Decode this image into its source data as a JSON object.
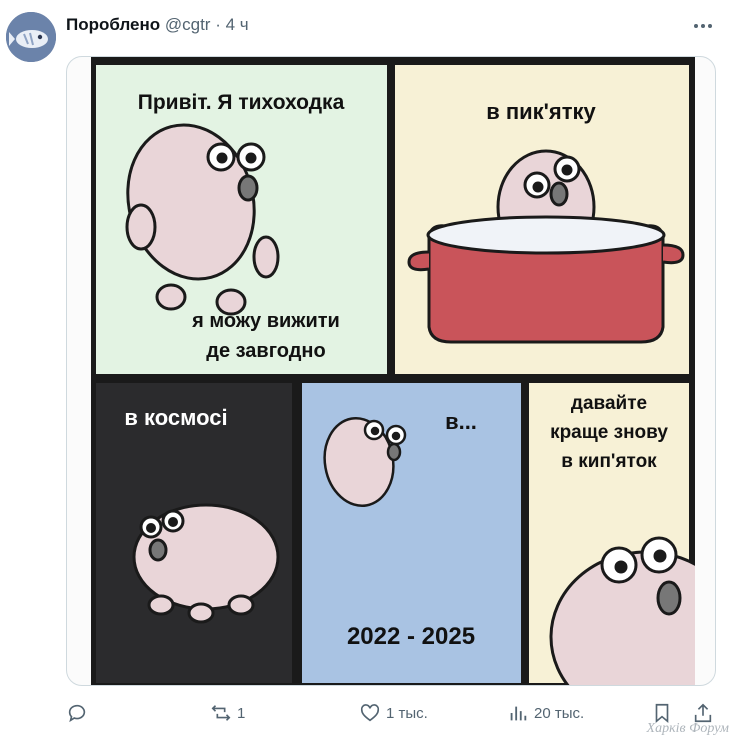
{
  "post": {
    "author_name": "Пороблено",
    "handle": "@cgtr",
    "separator": "·",
    "time": "4 ч"
  },
  "comic": {
    "panel1_top": "Привіт. Я тихоходка",
    "panel1_bottom_line1": "я можу вижити",
    "panel1_bottom_line2": "де завгодно",
    "panel2_top": "в пик'ятку",
    "panel3_top": "в космосі",
    "panel4_top": "в...",
    "panel4_bottom": "2022 - 2025",
    "panel5_line1": "давайте",
    "panel5_line2": "краще знову",
    "panel5_line3": "в кип'яток"
  },
  "actions": {
    "reply_count": "",
    "repost_count": "1",
    "like_count": "1 тыс.",
    "views_count": "20 тыс."
  },
  "watermark": "Харків Форум",
  "colors": {
    "panel1_bg": "#e3f3e3",
    "panel2_bg": "#f7f1d6",
    "panel3_bg": "#2b2b2d",
    "panel4_bg": "#a9c3e3",
    "panel5_bg": "#f7f1d6",
    "pot": "#c9545a",
    "creature": "#e9d5d8"
  }
}
